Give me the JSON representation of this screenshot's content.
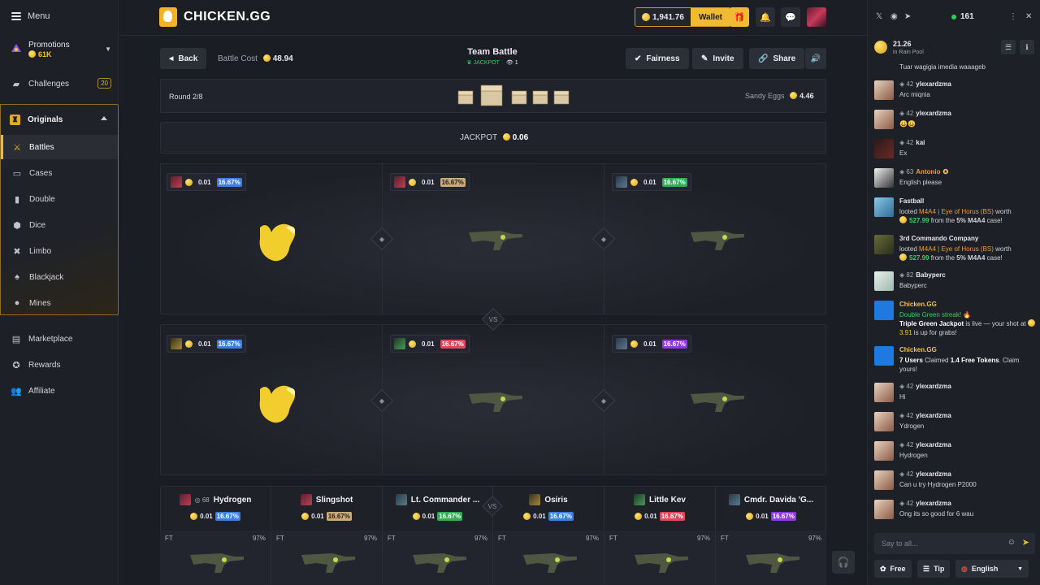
{
  "sidebar": {
    "menu_label": "Menu",
    "promotions": {
      "label": "Promotions",
      "amount": "61K"
    },
    "challenges": {
      "label": "Challenges",
      "badge": "20"
    },
    "originals_label": "Originals",
    "originals_items": [
      "Battles",
      "Cases",
      "Double",
      "Dice",
      "Limbo",
      "Blackjack",
      "Mines"
    ],
    "bottom_items": [
      "Marketplace",
      "Rewards",
      "Affiliate"
    ]
  },
  "topbar": {
    "brand": "CHICKEN.GG",
    "balance": "1,941.76",
    "wallet_label": "Wallet"
  },
  "battle": {
    "back_label": "Back",
    "cost_label": "Battle Cost",
    "cost_value": "48.94",
    "title": "Team Battle",
    "mode": "JACKPOT",
    "viewers": "1",
    "fairness_label": "Fairness",
    "invite_label": "Invite",
    "share_label": "Share",
    "round_label": "Round 2/8",
    "case_name": "Sandy Eggs",
    "case_value": "4.46",
    "jackpot_label": "JACKPOT",
    "jackpot_value": "0.06",
    "vs_label": "VS",
    "slots_top": [
      {
        "amount": "0.01",
        "pct": "16.67%",
        "color": "blue"
      },
      {
        "amount": "0.01",
        "pct": "16.67%",
        "color": "tan"
      },
      {
        "amount": "0.01",
        "pct": "16.67%",
        "color": "green"
      }
    ],
    "slots_bottom": [
      {
        "amount": "0.01",
        "pct": "16.67%",
        "color": "blue"
      },
      {
        "amount": "0.01",
        "pct": "16.67%",
        "color": "red"
      },
      {
        "amount": "0.01",
        "pct": "16.67%",
        "color": "purple"
      }
    ],
    "players": [
      {
        "name": "Hydrogen",
        "level": "68",
        "amount": "0.01",
        "pct": "16.67%",
        "color": "blue"
      },
      {
        "name": "Slingshot",
        "amount": "0.01",
        "pct": "16.67%",
        "color": "tan"
      },
      {
        "name": "Lt. Commander ...",
        "amount": "0.01",
        "pct": "16.67%",
        "color": "green"
      },
      {
        "name": "Osiris",
        "amount": "0.01",
        "pct": "16.67%",
        "color": "blue"
      },
      {
        "name": "Little Kev",
        "amount": "0.01",
        "pct": "16.67%",
        "color": "red"
      },
      {
        "name": "Cmdr. Davida 'G...",
        "amount": "0.01",
        "pct": "16.67%",
        "color": "purple"
      }
    ],
    "items": [
      {
        "wear": "FT",
        "chance": "97%"
      },
      {
        "wear": "FT",
        "chance": "97%"
      },
      {
        "wear": "FT",
        "chance": "97%"
      },
      {
        "wear": "FT",
        "chance": "97%"
      },
      {
        "wear": "FT",
        "chance": "97%"
      },
      {
        "wear": "FT",
        "chance": "97%"
      }
    ]
  },
  "chat": {
    "online": "161",
    "rain_amount": "21.26",
    "rain_label": "in Rain Pool",
    "first_line": "Tuar wagigia imedia waaageb",
    "messages": [
      {
        "level": "42",
        "user": "ylexardzma",
        "text": "Arc miqnia"
      },
      {
        "level": "42",
        "user": "ylexardzma",
        "text": "😀😀"
      },
      {
        "level": "42",
        "user": "kai",
        "text": "Ex"
      },
      {
        "level": "63",
        "user": "Antonio",
        "text": "English please"
      },
      {
        "user": "Fastball",
        "pre": "looted ",
        "item": "M4A4 | Eye of Horus (BS)",
        "mid": " worth",
        "amt": "527.99",
        "post1": " from the ",
        "case": "5% M4A4",
        "post2": " case!"
      },
      {
        "user": "3rd Commando Company",
        "pre": "looted ",
        "item": "M4A4 | Eye of Horus (BS)",
        "mid": " worth",
        "amt": "527.99",
        "post1": " from the ",
        "case": "5% M4A4",
        "post2": " case!"
      },
      {
        "level": "82",
        "user": "Babyperc",
        "text": "Babyperc"
      },
      {
        "user": "Chicken.GG",
        "streak": "Double Green streak! 🔥",
        "l2a": "Triple Green Jackpot",
        "l2b": " is live — your shot at ",
        "amt": "3.91",
        "l2c": " is up for grabs!"
      },
      {
        "user": "Chicken.GG",
        "c1": "7 Users",
        "c2": " Claimed ",
        "c3": "1.4 Free Tokens",
        "c4": ". Claim yours!"
      },
      {
        "level": "42",
        "user": "ylexardzma",
        "text": "Hi"
      },
      {
        "level": "42",
        "user": "ylexardzma",
        "text": "Ydrogen"
      },
      {
        "level": "42",
        "user": "ylexardzma",
        "text": "Hydrogen"
      },
      {
        "level": "42",
        "user": "ylexardzma",
        "text": "Can u try Hydrogen P2000"
      },
      {
        "level": "42",
        "user": "ylexardzma",
        "text": "Ong its so good for 6 wau"
      }
    ],
    "input_placeholder": "Say to all...",
    "free_label": "Free",
    "tip_label": "Tip",
    "language": "English"
  },
  "colors": {
    "accent": "#f0bb32",
    "blue": "#3d7ee0",
    "tan": "#c9aa7a",
    "green": "#2fae53",
    "red": "#e0485a",
    "purple": "#8d3be0"
  }
}
